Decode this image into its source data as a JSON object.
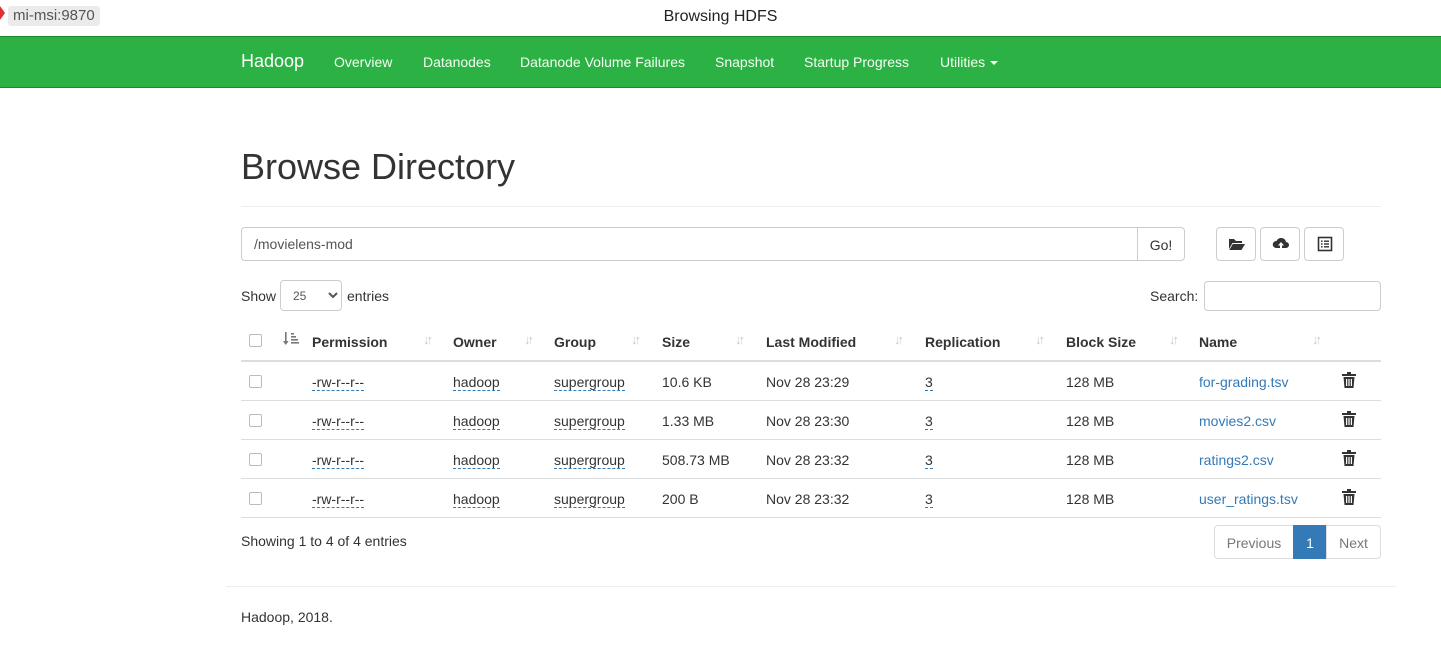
{
  "window": {
    "host": "mi-msi:9870",
    "title": "Browsing HDFS"
  },
  "navbar": {
    "brand": "Hadoop",
    "items": [
      "Overview",
      "Datanodes",
      "Datanode Volume Failures",
      "Snapshot",
      "Startup Progress",
      "Utilities"
    ]
  },
  "page_title": "Browse Directory",
  "path": {
    "value": "/movielens-mod",
    "go_label": "Go!"
  },
  "tools": [
    "folder-open-icon",
    "cloud-upload-icon",
    "list-alt-icon"
  ],
  "show": {
    "label_before": "Show",
    "selected": "25",
    "label_after": "entries"
  },
  "search": {
    "label": "Search:",
    "value": ""
  },
  "table": {
    "headers": [
      "Permission",
      "Owner",
      "Group",
      "Size",
      "Last Modified",
      "Replication",
      "Block Size",
      "Name"
    ],
    "rows": [
      [
        "-rw-r--r--",
        "hadoop",
        "supergroup",
        "10.6 KB",
        "Nov 28 23:29",
        "3",
        "128 MB",
        "for-grading.tsv"
      ],
      [
        "-rw-r--r--",
        "hadoop",
        "supergroup",
        "1.33 MB",
        "Nov 28 23:30",
        "3",
        "128 MB",
        "movies2.csv"
      ],
      [
        "-rw-r--r--",
        "hadoop",
        "supergroup",
        "508.73 MB",
        "Nov 28 23:32",
        "3",
        "128 MB",
        "ratings2.csv"
      ],
      [
        "-rw-r--r--",
        "hadoop",
        "supergroup",
        "200 B",
        "Nov 28 23:32",
        "3",
        "128 MB",
        "user_ratings.tsv"
      ]
    ]
  },
  "info": "Showing 1 to 4 of 4 entries",
  "pagination": {
    "previous": "Previous",
    "current": "1",
    "next": "Next"
  },
  "footer": "Hadoop, 2018.",
  "colors": {
    "navbar": "#2cb144",
    "link": "#337ab7",
    "pager_active": "#337ab7"
  }
}
